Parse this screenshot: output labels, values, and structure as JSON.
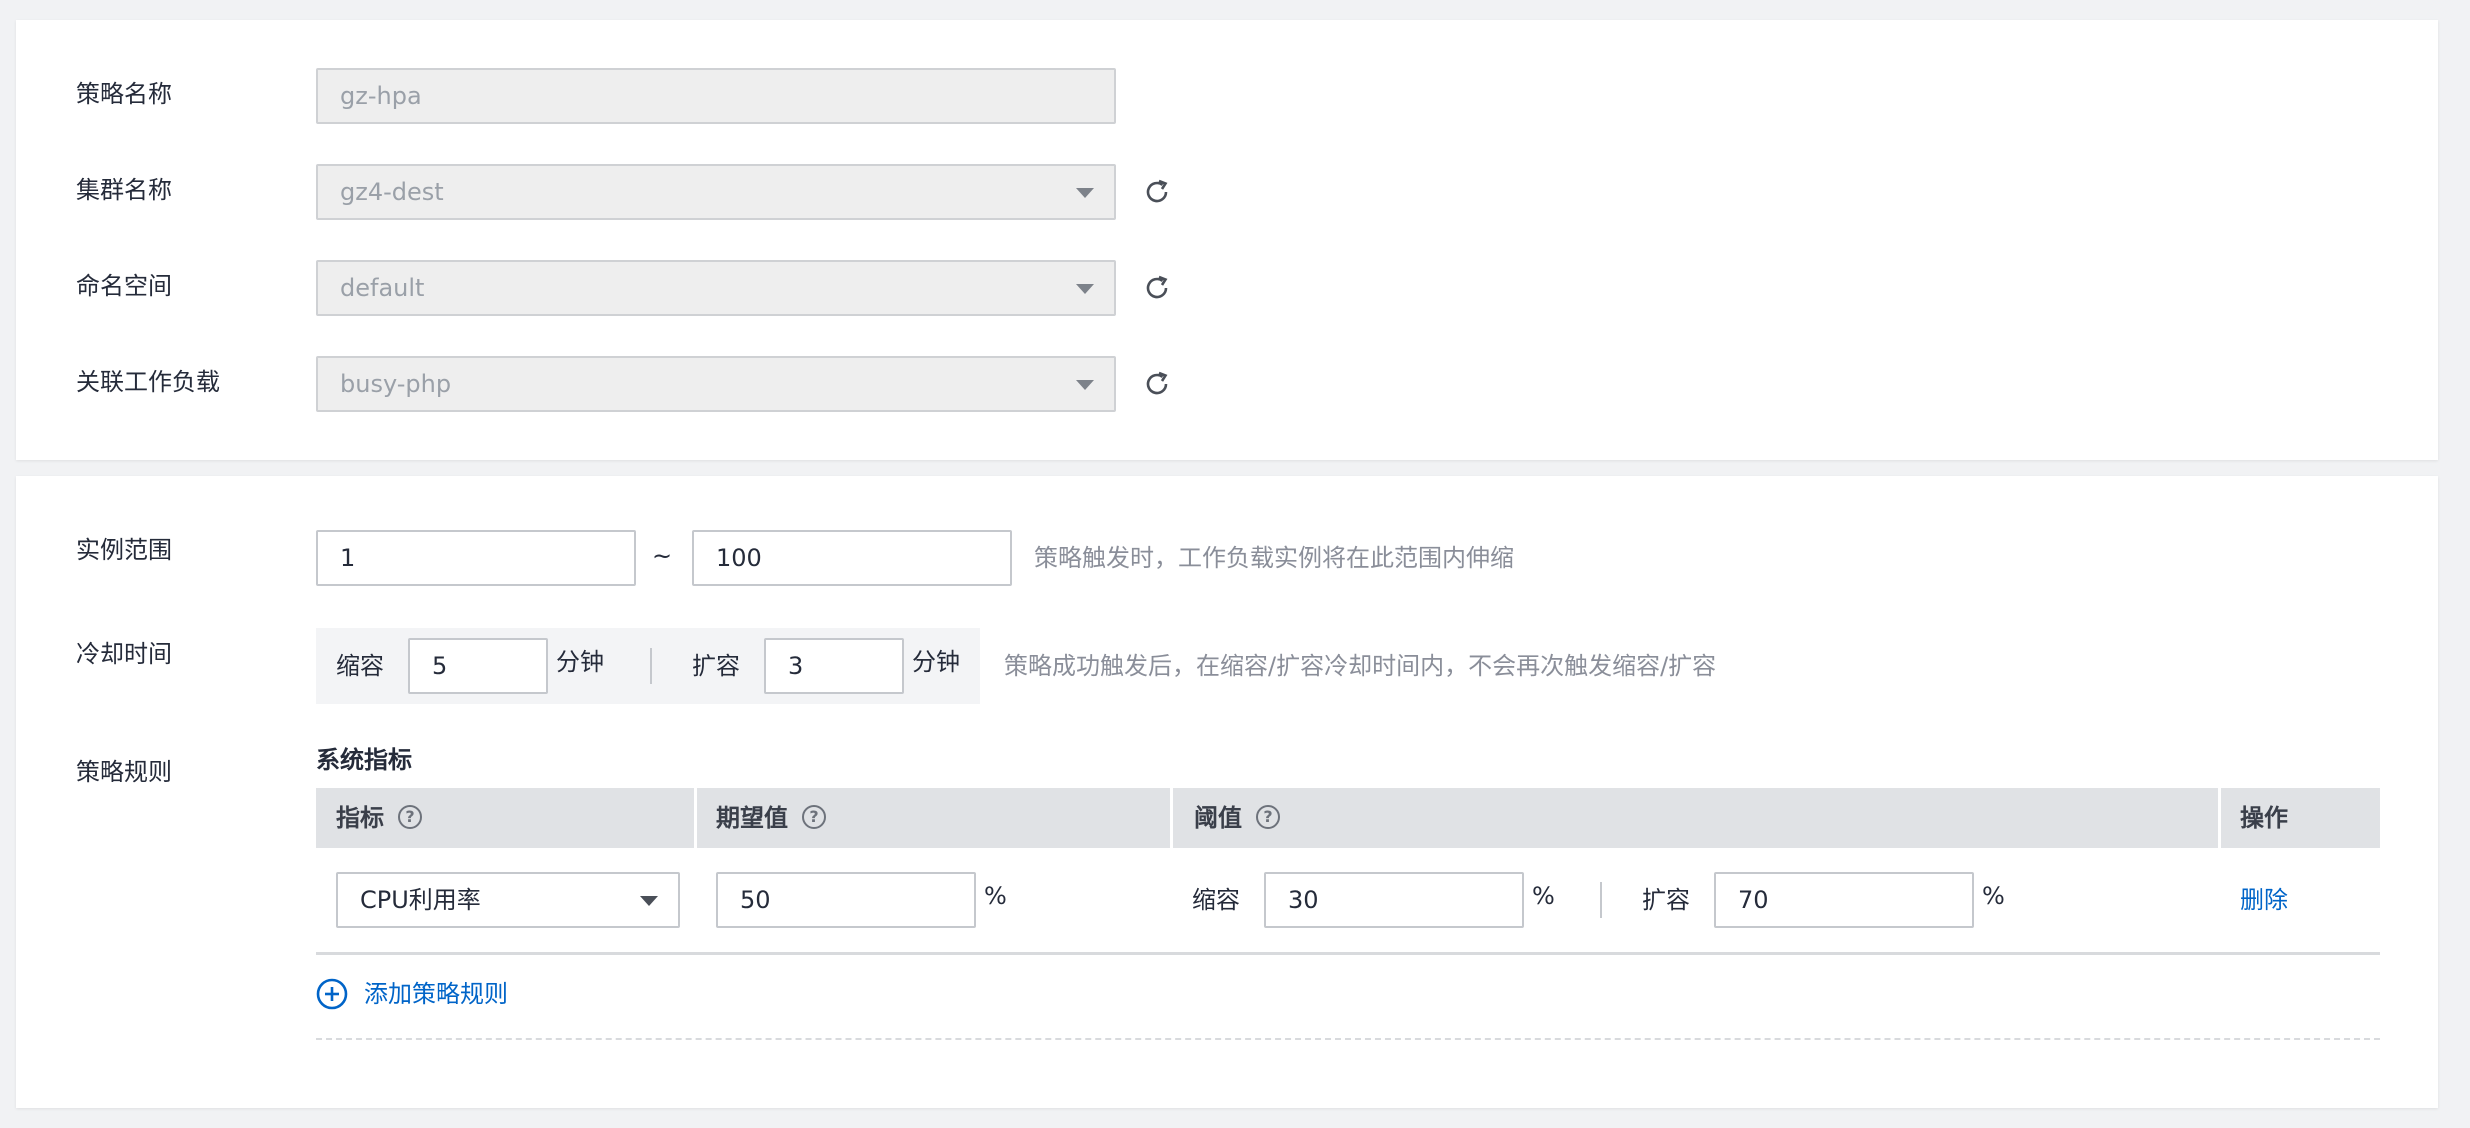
{
  "basic": {
    "policy_name_label": "策略名称",
    "policy_name_value": "gz-hpa",
    "cluster_label": "集群名称",
    "cluster_value": "gz4-dest",
    "namespace_label": "命名空间",
    "namespace_value": "default",
    "workload_label": "关联工作负载",
    "workload_value": "busy-php"
  },
  "scaling": {
    "instance_range_label": "实例范围",
    "range_min": "1",
    "range_separator": "~",
    "range_max": "100",
    "range_hint": "策略触发时，工作负载实例将在此范围内伸缩",
    "cooldown_label": "冷却时间",
    "scale_in_label": "缩容",
    "scale_in_value": "5",
    "scale_in_unit": "分钟",
    "scale_out_label": "扩容",
    "scale_out_value": "3",
    "scale_out_unit": "分钟",
    "cooldown_hint": "策略成功触发后，在缩容/扩容冷却时间内，不会再次触发缩容/扩容"
  },
  "rules": {
    "label": "策略规则",
    "section_title": "系统指标",
    "headers": {
      "metric": "指标",
      "expected": "期望值",
      "threshold": "阈值",
      "action": "操作"
    },
    "help_glyph": "?",
    "row": {
      "metric": "CPU利用率",
      "expected": "50",
      "expected_unit": "%",
      "scale_in_label": "缩容",
      "scale_in_value": "30",
      "scale_in_unit": "%",
      "scale_out_label": "扩容",
      "scale_out_value": "70",
      "scale_out_unit": "%",
      "delete": "删除"
    },
    "add_rule": "添加策略规则"
  },
  "colors": {
    "link": "#0064c8",
    "hint": "#8a8e99",
    "header_bg": "#e0e2e5",
    "disabled_bg": "#eeeeee"
  }
}
